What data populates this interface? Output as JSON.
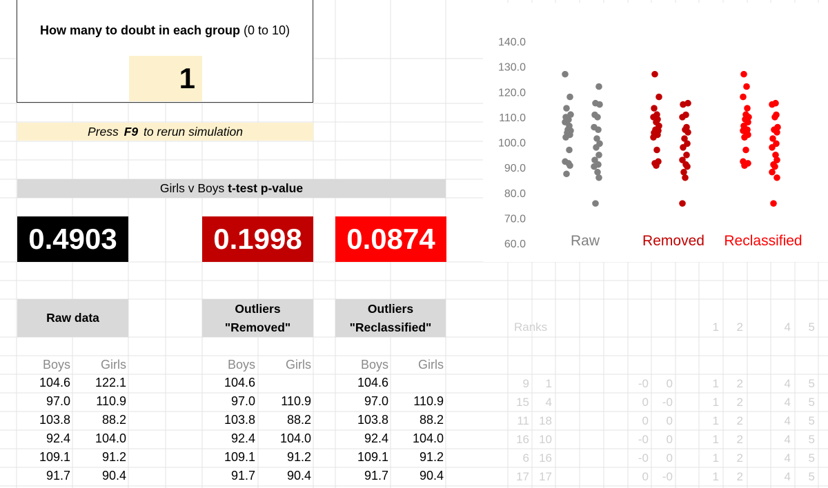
{
  "doubt": {
    "title_bold": "How many to doubt in each group",
    "title_range": "(0 to 10)",
    "value": "1"
  },
  "press_hint": {
    "prefix": "Press",
    "key": "F9",
    "suffix": "to rerun simulation"
  },
  "pvalues": {
    "header_prefix": "Girls v Boys",
    "header_bold": "t-test p-value",
    "raw": "0.4903",
    "removed": "0.1998",
    "reclassified": "0.0874",
    "colors": {
      "raw": "#000000",
      "removed": "#c00000",
      "reclassified": "#ff0000"
    }
  },
  "sections": {
    "raw_title": "Raw data",
    "removed_title_1": "Outliers",
    "removed_title_2": "\"Removed\"",
    "reclassified_title_1": "Outliers",
    "reclassified_title_2": "\"Reclassified\""
  },
  "columns": {
    "boys": "Boys",
    "girls": "Girls"
  },
  "table": {
    "raw": [
      [
        "104.6",
        "122.1"
      ],
      [
        "97.0",
        "110.9"
      ],
      [
        "103.8",
        "88.2"
      ],
      [
        "92.4",
        "104.0"
      ],
      [
        "109.1",
        "91.2"
      ],
      [
        "91.7",
        "90.4"
      ]
    ],
    "removed": [
      [
        "104.6",
        ""
      ],
      [
        "97.0",
        "110.9"
      ],
      [
        "103.8",
        "88.2"
      ],
      [
        "92.4",
        "104.0"
      ],
      [
        "109.1",
        "91.2"
      ],
      [
        "91.7",
        "90.4"
      ]
    ],
    "reclassified": [
      [
        "104.6",
        ""
      ],
      [
        "97.0",
        "110.9"
      ],
      [
        "103.8",
        "88.2"
      ],
      [
        "92.4",
        "104.0"
      ],
      [
        "109.1",
        "91.2"
      ],
      [
        "91.7",
        "90.4"
      ]
    ]
  },
  "ranks": {
    "label": "Ranks",
    "header_nums": [
      "1",
      "2",
      "4",
      "5"
    ],
    "rows": [
      [
        "9",
        "1",
        "-0",
        "0",
        "1",
        "2",
        "4",
        "5"
      ],
      [
        "15",
        "4",
        "0",
        "-0",
        "1",
        "2",
        "4",
        "5"
      ],
      [
        "11",
        "18",
        "0",
        "0",
        "1",
        "2",
        "4",
        "5"
      ],
      [
        "16",
        "10",
        "-0",
        "0",
        "1",
        "2",
        "4",
        "5"
      ],
      [
        "6",
        "16",
        "-0",
        "0",
        "1",
        "2",
        "4",
        "5"
      ],
      [
        "17",
        "17",
        "0",
        "-0",
        "1",
        "2",
        "4",
        "5"
      ]
    ]
  },
  "chart_data": {
    "type": "scatter",
    "ylim": [
      60,
      140
    ],
    "yticks": [
      "60.0",
      "70.0",
      "80.0",
      "90.0",
      "100.0",
      "110.0",
      "120.0",
      "130.0",
      "140.0"
    ],
    "grid": false,
    "groups": [
      {
        "label": "Raw",
        "color": "#808080"
      },
      {
        "label": "Removed",
        "color": "#c00000"
      },
      {
        "label": "Reclassified",
        "color": "#ff0000"
      }
    ],
    "series": [
      {
        "group": 0,
        "sub": 0,
        "color": "#808080",
        "values": [
          127.0,
          118.0,
          113.5,
          111.0,
          110.0,
          109.0,
          108.0,
          106.5,
          105.0,
          104.6,
          103.8,
          103.0,
          102.0,
          97.0,
          92.4,
          91.7,
          90.8,
          87.5
        ]
      },
      {
        "group": 0,
        "sub": 1,
        "color": "#808080",
        "values": [
          122.1,
          115.5,
          115.0,
          110.9,
          110.0,
          106.0,
          105.0,
          101.5,
          99.5,
          98.0,
          95.0,
          93.0,
          91.2,
          90.4,
          88.2,
          86.0,
          75.8
        ]
      },
      {
        "group": 1,
        "sub": 0,
        "color": "#c00000",
        "values": [
          127.0,
          118.0,
          113.5,
          111.0,
          110.0,
          109.1,
          108.0,
          106.5,
          105.0,
          104.6,
          103.8,
          103.0,
          102.0,
          97.0,
          92.4,
          91.7,
          90.8
        ]
      },
      {
        "group": 1,
        "sub": 1,
        "color": "#c00000",
        "values": [
          115.5,
          115.0,
          110.9,
          110.0,
          106.0,
          105.0,
          104.0,
          101.5,
          99.5,
          98.0,
          95.0,
          93.0,
          91.2,
          90.4,
          88.2,
          86.0,
          75.8
        ]
      },
      {
        "group": 2,
        "sub": 0,
        "color": "#ff0000",
        "values": [
          127.0,
          122.1,
          118.0,
          113.5,
          111.0,
          110.0,
          109.1,
          108.0,
          106.5,
          105.0,
          104.6,
          103.8,
          103.0,
          102.0,
          97.0,
          92.4,
          91.7,
          90.8
        ]
      },
      {
        "group": 2,
        "sub": 1,
        "color": "#ff0000",
        "values": [
          115.5,
          115.0,
          110.9,
          110.0,
          106.0,
          105.0,
          104.0,
          101.5,
          99.5,
          98.0,
          95.0,
          93.0,
          91.2,
          90.4,
          88.2,
          86.0,
          75.8
        ]
      }
    ]
  }
}
